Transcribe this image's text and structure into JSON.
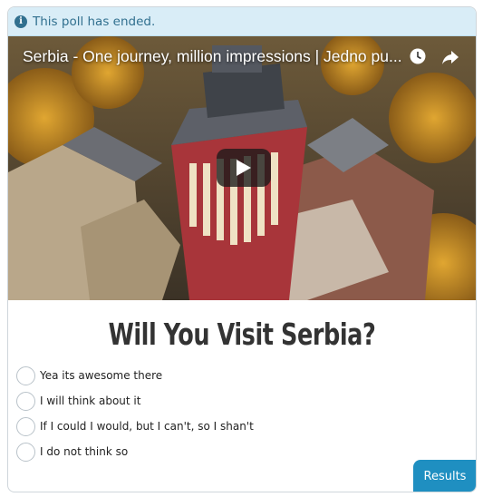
{
  "notice": {
    "text": "This poll has ended.",
    "icon": "info-icon"
  },
  "video": {
    "title": "Serbia - One journey, million impressions | Jedno pu...",
    "icons": [
      "clock-icon",
      "share-icon",
      "play-icon"
    ]
  },
  "poll": {
    "question": "Will You Visit Serbia?",
    "options": [
      "Yea its awesome there",
      "I will think about it",
      "If I could I would, but I can't, so I shan't",
      "I do not think so"
    ],
    "results_label": "Results"
  },
  "colors": {
    "notice_bg": "#d9edf7",
    "notice_text": "#31708f",
    "button": "#1f8fc1"
  }
}
